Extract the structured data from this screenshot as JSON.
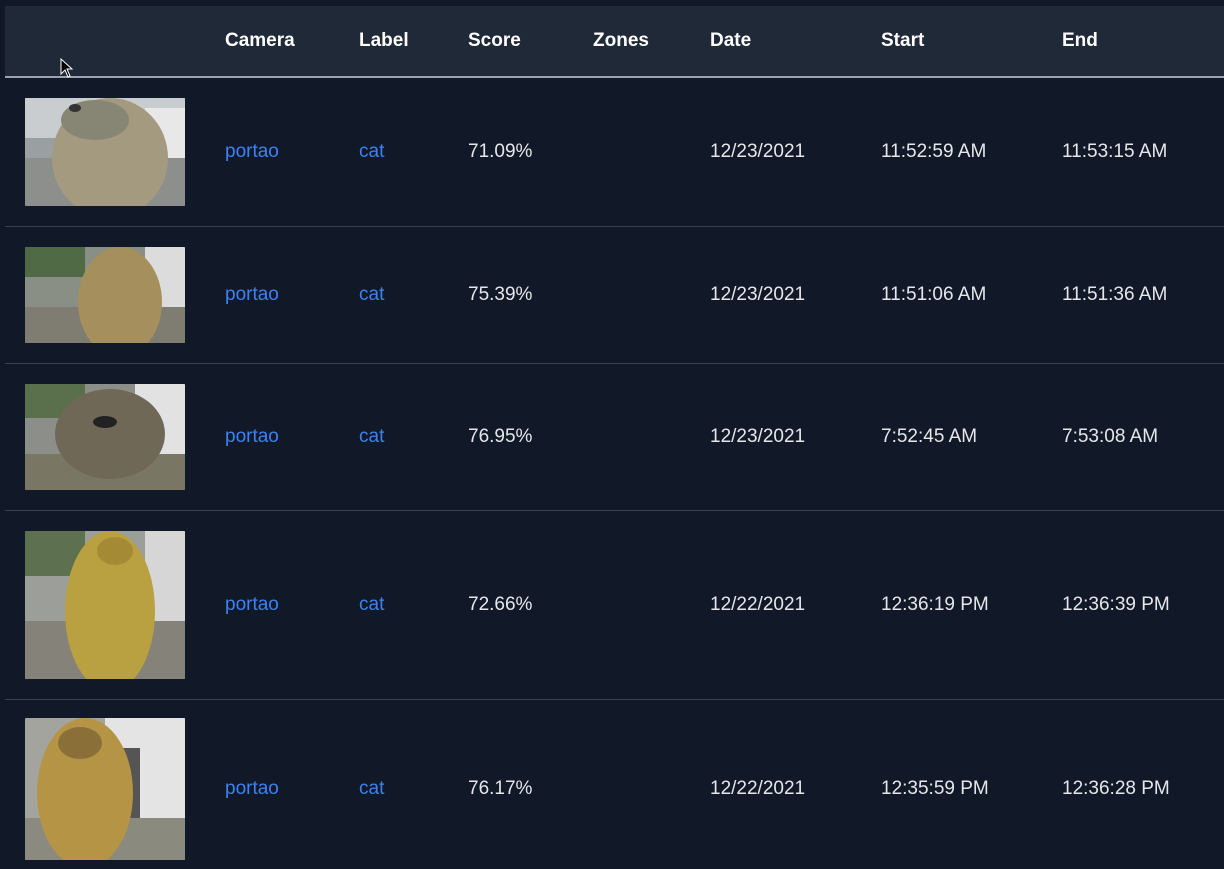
{
  "table": {
    "headers": {
      "thumbnail": "",
      "camera": "Camera",
      "label": "Label",
      "score": "Score",
      "zones": "Zones",
      "date": "Date",
      "start": "Start",
      "end": "End"
    },
    "rows": [
      {
        "camera": "portao",
        "label": "cat",
        "score": "71.09%",
        "zones": "",
        "date": "12/23/2021",
        "start": "11:52:59 AM",
        "end": "11:53:15 AM"
      },
      {
        "camera": "portao",
        "label": "cat",
        "score": "75.39%",
        "zones": "",
        "date": "12/23/2021",
        "start": "11:51:06 AM",
        "end": "11:51:36 AM"
      },
      {
        "camera": "portao",
        "label": "cat",
        "score": "76.95%",
        "zones": "",
        "date": "12/23/2021",
        "start": "7:52:45 AM",
        "end": "7:53:08 AM"
      },
      {
        "camera": "portao",
        "label": "cat",
        "score": "72.66%",
        "zones": "",
        "date": "12/22/2021",
        "start": "12:36:19 PM",
        "end": "12:36:39 PM"
      },
      {
        "camera": "portao",
        "label": "cat",
        "score": "76.17%",
        "zones": "",
        "date": "12/22/2021",
        "start": "12:35:59 PM",
        "end": "12:36:28 PM"
      }
    ]
  },
  "colors": {
    "background": "#111827",
    "header_background": "#1f2937",
    "link": "#3b82f6",
    "text": "#e5e7eb"
  }
}
